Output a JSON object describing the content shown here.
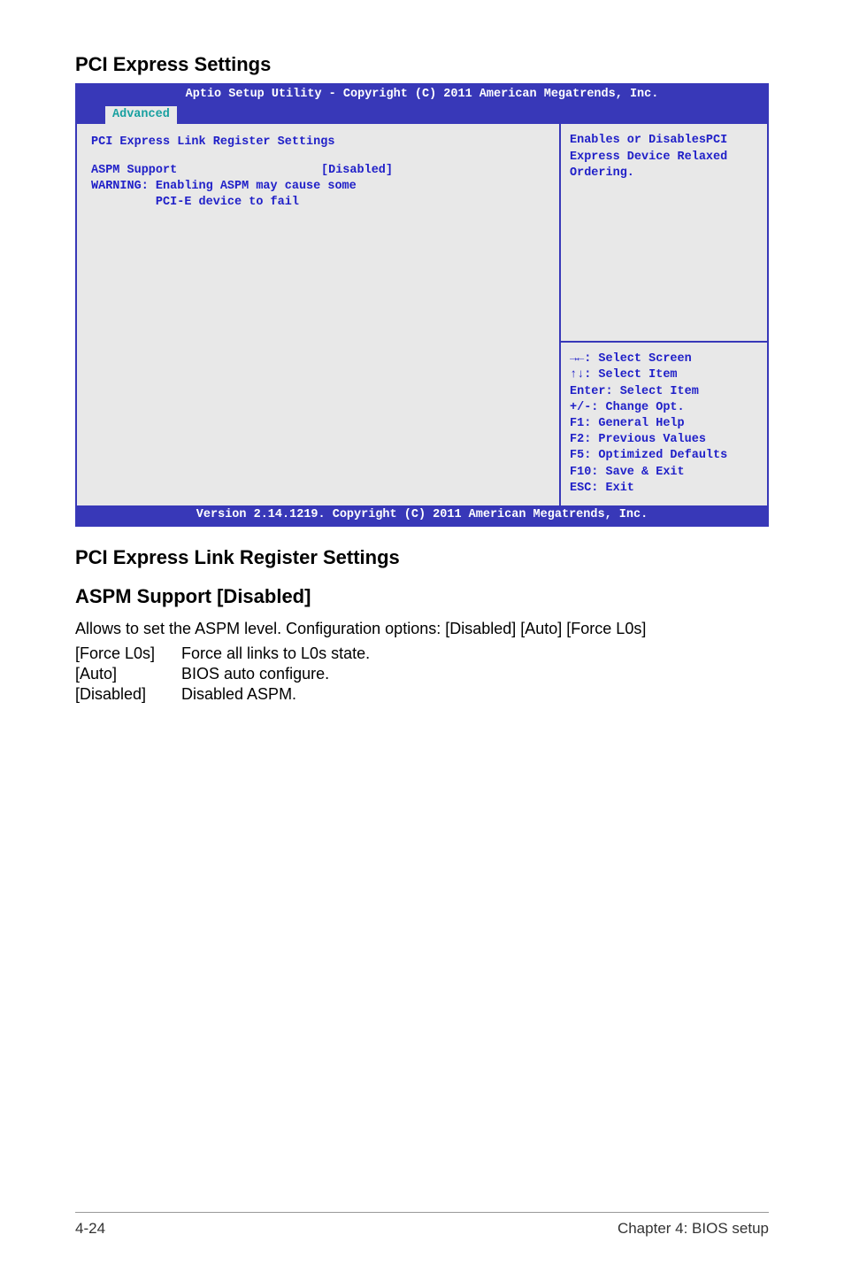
{
  "heading": "PCI Express Settings",
  "bios": {
    "header": "Aptio Setup Utility - Copyright (C) 2011 American Megatrends, Inc.",
    "tab": "Advanced",
    "sectionTitle": "PCI Express Link Register Settings",
    "setting": {
      "label": "ASPM Support",
      "value": "[Disabled]"
    },
    "warning1": "WARNING: Enabling ASPM may cause some",
    "warning2": "         PCI-E device to fail",
    "helpDesc1": "Enables or DisablesPCI",
    "helpDesc2": "Express Device Relaxed",
    "helpDesc3": "Ordering.",
    "nav1": "→←: Select Screen",
    "nav2": "↑↓:  Select Item",
    "nav3": "Enter: Select Item",
    "nav4": "+/-: Change Opt.",
    "nav5": "F1: General Help",
    "nav6": "F2: Previous Values",
    "nav7": "F5: Optimized Defaults",
    "nav8": "F10: Save & Exit",
    "nav9": "ESC: Exit",
    "footer": "Version 2.14.1219. Copyright (C) 2011 American Megatrends, Inc."
  },
  "subHeading1": "PCI Express Link Register Settings",
  "subHeading2": "ASPM Support [Disabled]",
  "descLine": "Allows to set the ASPM level. Configuration options: [Disabled] [Auto] [Force L0s]",
  "opts": [
    {
      "key": "[Force L0s]",
      "desc": "Force all links to L0s state."
    },
    {
      "key": "[Auto]",
      "desc": "BIOS auto configure."
    },
    {
      "key": "[Disabled]",
      "desc": "Disabled ASPM."
    }
  ],
  "pageNum": "4-24",
  "chapter": "Chapter 4: BIOS setup"
}
